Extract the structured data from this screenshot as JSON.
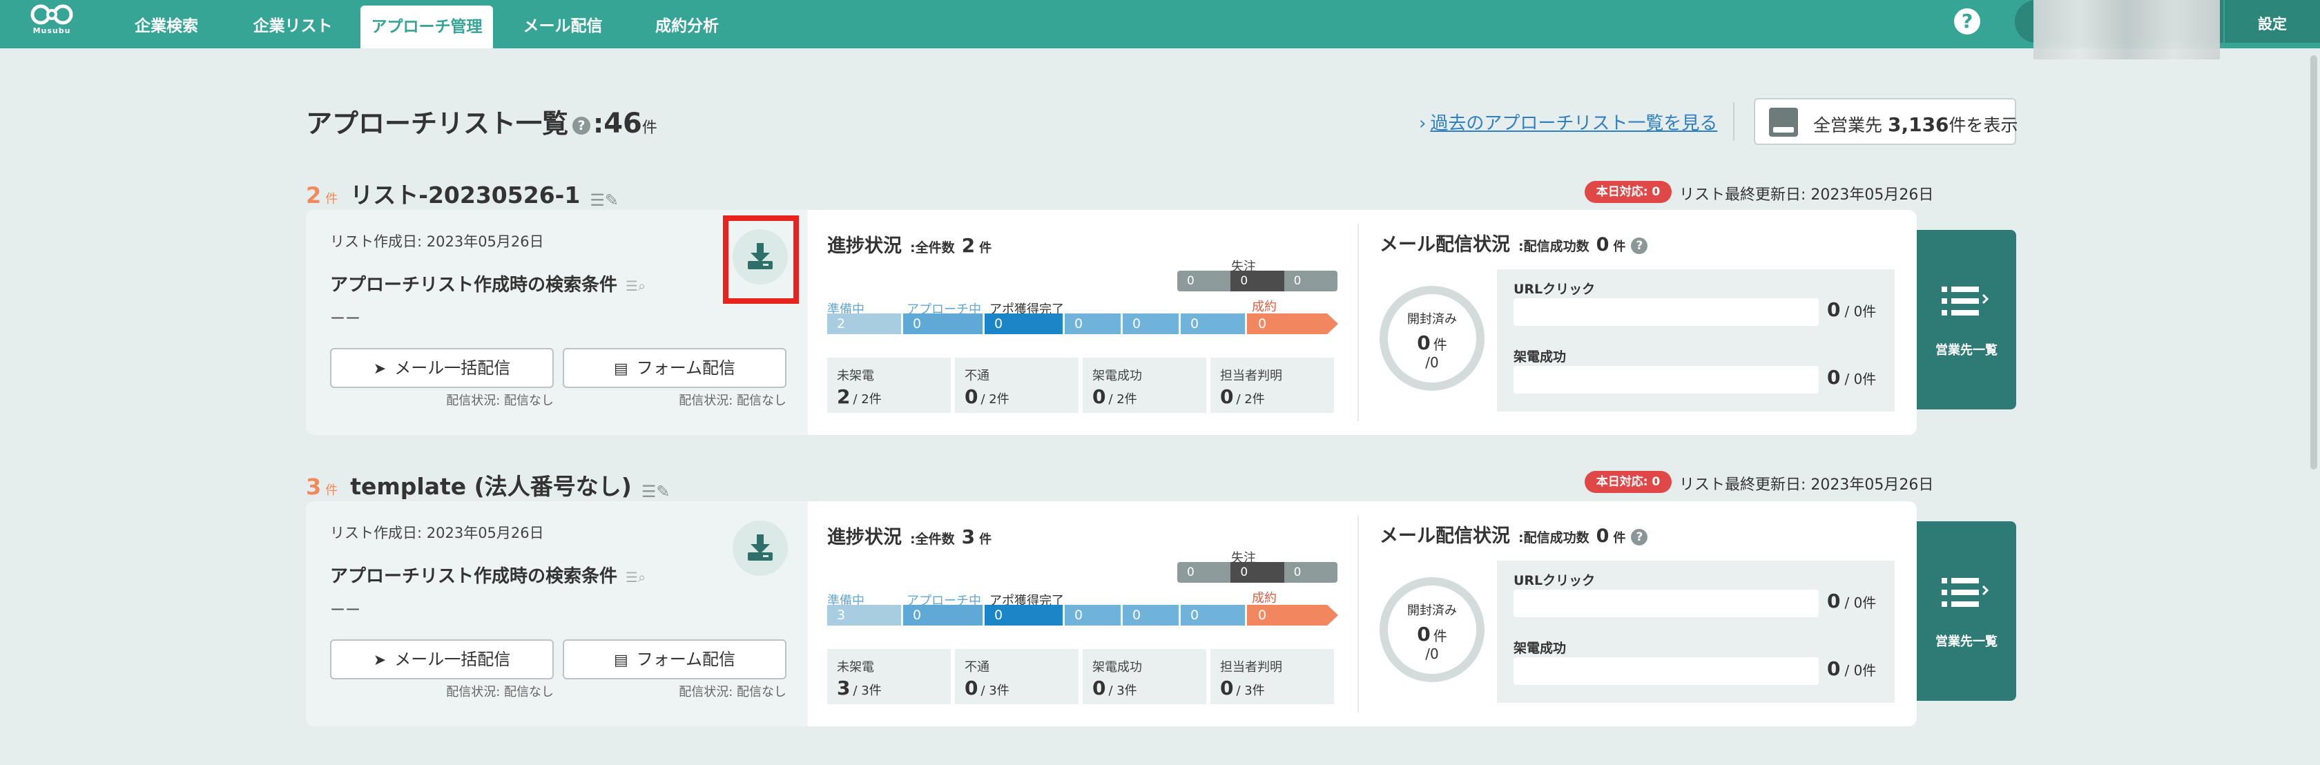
{
  "nav": {
    "logo_text": "Musubu",
    "items": [
      {
        "label": "企業検索",
        "active": false
      },
      {
        "label": "企業リスト",
        "active": false
      },
      {
        "label": "アプローチ管理",
        "active": true
      },
      {
        "label": "メール配信",
        "active": false
      },
      {
        "label": "成約分析",
        "active": false
      }
    ],
    "help_icon": "question-icon",
    "settings_label": "設定"
  },
  "header": {
    "title": "アプローチリスト一覧",
    "title_help": "?",
    "colon": ":",
    "total": "46",
    "total_unit": "件",
    "past_link": "過去のアプローチリスト一覧を見る",
    "all_button_prefix": "全営業先",
    "all_button_count": "3,136",
    "all_button_suffix": "件を表示"
  },
  "lists": [
    {
      "count": "2",
      "count_unit": "件",
      "name": "リスト-20230526-1",
      "today_badge": "本日対応: 0",
      "last_updated": "リスト最終更新日: 2023年05月26日",
      "created": "リスト作成日: 2023年05月26日",
      "cond_title": "アプローチリスト作成時の検索条件",
      "cond_value": "ーー",
      "download_highlighted": true,
      "mail_btn": "メール一括配信",
      "form_btn": "フォーム配信",
      "mail_status": "配信状況: 配信なし",
      "form_status": "配信状況: 配信なし",
      "progress": {
        "title": "進捗状況",
        "sub": ":全件数",
        "total": "2",
        "unit": "件",
        "lost_label": "失注",
        "lost": [
          "0",
          "0",
          "0"
        ],
        "stage_labels": [
          "準備中",
          "アプローチ中",
          "アポ獲得完了"
        ],
        "stages": [
          "2",
          "0",
          "0",
          "0",
          "0",
          "0"
        ],
        "won_label": "成約",
        "won": "0",
        "stats": [
          {
            "label": "未架電",
            "value": "2",
            "total": "2件"
          },
          {
            "label": "不通",
            "value": "0",
            "total": "2件"
          },
          {
            "label": "架電成功",
            "value": "0",
            "total": "2件"
          },
          {
            "label": "担当者判明",
            "value": "0",
            "total": "2件"
          }
        ]
      },
      "mail": {
        "title": "メール配信状況",
        "sub": ":配信成功数",
        "value": "0",
        "unit": "件",
        "help": "?",
        "opened_label": "開封済み",
        "opened_value": "0",
        "opened_unit": "件",
        "opened_denom": "/0",
        "url_click_label": "URLクリック",
        "url_click_value": "0",
        "url_click_total": "/ 0件",
        "call_success_label": "架電成功",
        "call_success_value": "0",
        "call_success_total": "/ 0件"
      },
      "side_button": "営業先一覧"
    },
    {
      "count": "3",
      "count_unit": "件",
      "name": "template (法人番号なし)",
      "today_badge": "本日対応: 0",
      "last_updated": "リスト最終更新日: 2023年05月26日",
      "created": "リスト作成日: 2023年05月26日",
      "cond_title": "アプローチリスト作成時の検索条件",
      "cond_value": "ーー",
      "download_highlighted": false,
      "mail_btn": "メール一括配信",
      "form_btn": "フォーム配信",
      "mail_status": "配信状況: 配信なし",
      "form_status": "配信状況: 配信なし",
      "progress": {
        "title": "進捗状況",
        "sub": ":全件数",
        "total": "3",
        "unit": "件",
        "lost_label": "失注",
        "lost": [
          "0",
          "0",
          "0"
        ],
        "stage_labels": [
          "準備中",
          "アプローチ中",
          "アポ獲得完了"
        ],
        "stages": [
          "3",
          "0",
          "0",
          "0",
          "0",
          "0"
        ],
        "won_label": "成約",
        "won": "0",
        "stats": [
          {
            "label": "未架電",
            "value": "3",
            "total": "3件"
          },
          {
            "label": "不通",
            "value": "0",
            "total": "3件"
          },
          {
            "label": "架電成功",
            "value": "0",
            "total": "3件"
          },
          {
            "label": "担当者判明",
            "value": "0",
            "total": "3件"
          }
        ]
      },
      "mail": {
        "title": "メール配信状況",
        "sub": ":配信成功数",
        "value": "0",
        "unit": "件",
        "help": "?",
        "opened_label": "開封済み",
        "opened_value": "0",
        "opened_unit": "件",
        "opened_denom": "/0",
        "url_click_label": "URLクリック",
        "url_click_value": "0",
        "url_click_total": "/ 0件",
        "call_success_label": "架電成功",
        "call_success_value": "0",
        "call_success_total": "/ 0件"
      },
      "side_button": "営業先一覧"
    }
  ],
  "colors": {
    "brand": "#36a596",
    "accent_orange": "#f08a5d",
    "highlight_red": "#e8231e",
    "stage_prep": "#a9cde0",
    "stage_approach": "#5fa9d6",
    "stage_apo": "#1a86c8",
    "stage_other": "#6fb3db",
    "lost_dark": "#4c4c4c",
    "lost_grey": "#8c9a9a"
  }
}
